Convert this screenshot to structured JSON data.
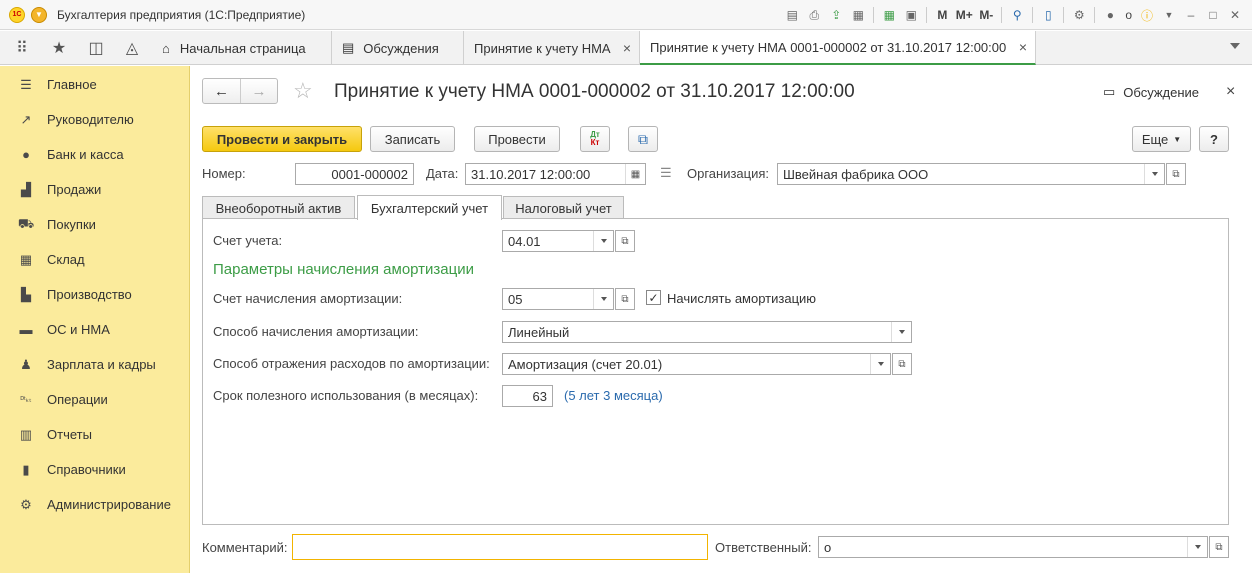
{
  "titlebar": {
    "app_title": "Бухгалтерия предприятия  (1С:Предприятие)",
    "logo_text": "1С",
    "m_label": "M",
    "m_plus_label": "M+",
    "m_minus_label": "M-",
    "user": "o"
  },
  "tabs": [
    {
      "label": "Начальная страница"
    },
    {
      "label": "Обсуждения"
    },
    {
      "label": "Принятие к учету НМА"
    },
    {
      "label": "Принятие к учету НМА 0001-000002 от 31.10.2017 12:00:00"
    }
  ],
  "sidebar": {
    "items": [
      {
        "label": "Главное",
        "icon": "menu-icon"
      },
      {
        "label": "Руководителю",
        "icon": "chart-line-icon"
      },
      {
        "label": "Банк и касса",
        "icon": "coin-icon"
      },
      {
        "label": "Продажи",
        "icon": "bag-icon"
      },
      {
        "label": "Покупки",
        "icon": "cart-icon"
      },
      {
        "label": "Склад",
        "icon": "warehouse-icon"
      },
      {
        "label": "Производство",
        "icon": "factory-icon"
      },
      {
        "label": "ОС и НМА",
        "icon": "truck-icon"
      },
      {
        "label": "Зарплата и кадры",
        "icon": "person-icon"
      },
      {
        "label": "Операции",
        "icon": "dtkt-icon"
      },
      {
        "label": "Отчеты",
        "icon": "bar-chart-icon"
      },
      {
        "label": "Справочники",
        "icon": "book-icon"
      },
      {
        "label": "Администрирование",
        "icon": "gear-icon"
      }
    ]
  },
  "form": {
    "title": "Принятие к учету НМА 0001-000002 от 31.10.2017 12:00:00",
    "discuss_label": "Обсуждение",
    "buttons": {
      "post_close": "Провести и закрыть",
      "save": "Записать",
      "post": "Провести",
      "dt": "Дт",
      "kt": "Кт",
      "more": "Еще",
      "help": "?"
    },
    "number_label": "Номер:",
    "number_value": "0001-000002",
    "date_label": "Дата:",
    "date_value": "31.10.2017 12:00:00",
    "org_label": "Организация:",
    "org_value": "Швейная фабрика ООО",
    "form_tabs": [
      "Внеоборотный актив",
      "Бухгалтерский учет",
      "Налоговый учет"
    ],
    "account_label": "Счет учета:",
    "account_value": "04.01",
    "section_title": "Параметры начисления амортизации",
    "amort_account_label": "Счет начисления амортизации:",
    "amort_account_value": "05",
    "accrue_label": "Начислять амортизацию",
    "accrue_checked": true,
    "method_label": "Способ начисления амортизации:",
    "method_value": "Линейный",
    "expense_label": "Способ отражения расходов по амортизации:",
    "expense_value": "Амортизация (счет 20.01)",
    "term_label": "Срок полезного использования (в месяцах):",
    "term_value": "63",
    "term_hint": "(5 лет 3 месяца)",
    "comment_label": "Комментарий:",
    "comment_value": "",
    "responsible_label": "Ответственный:",
    "responsible_value": "o"
  }
}
